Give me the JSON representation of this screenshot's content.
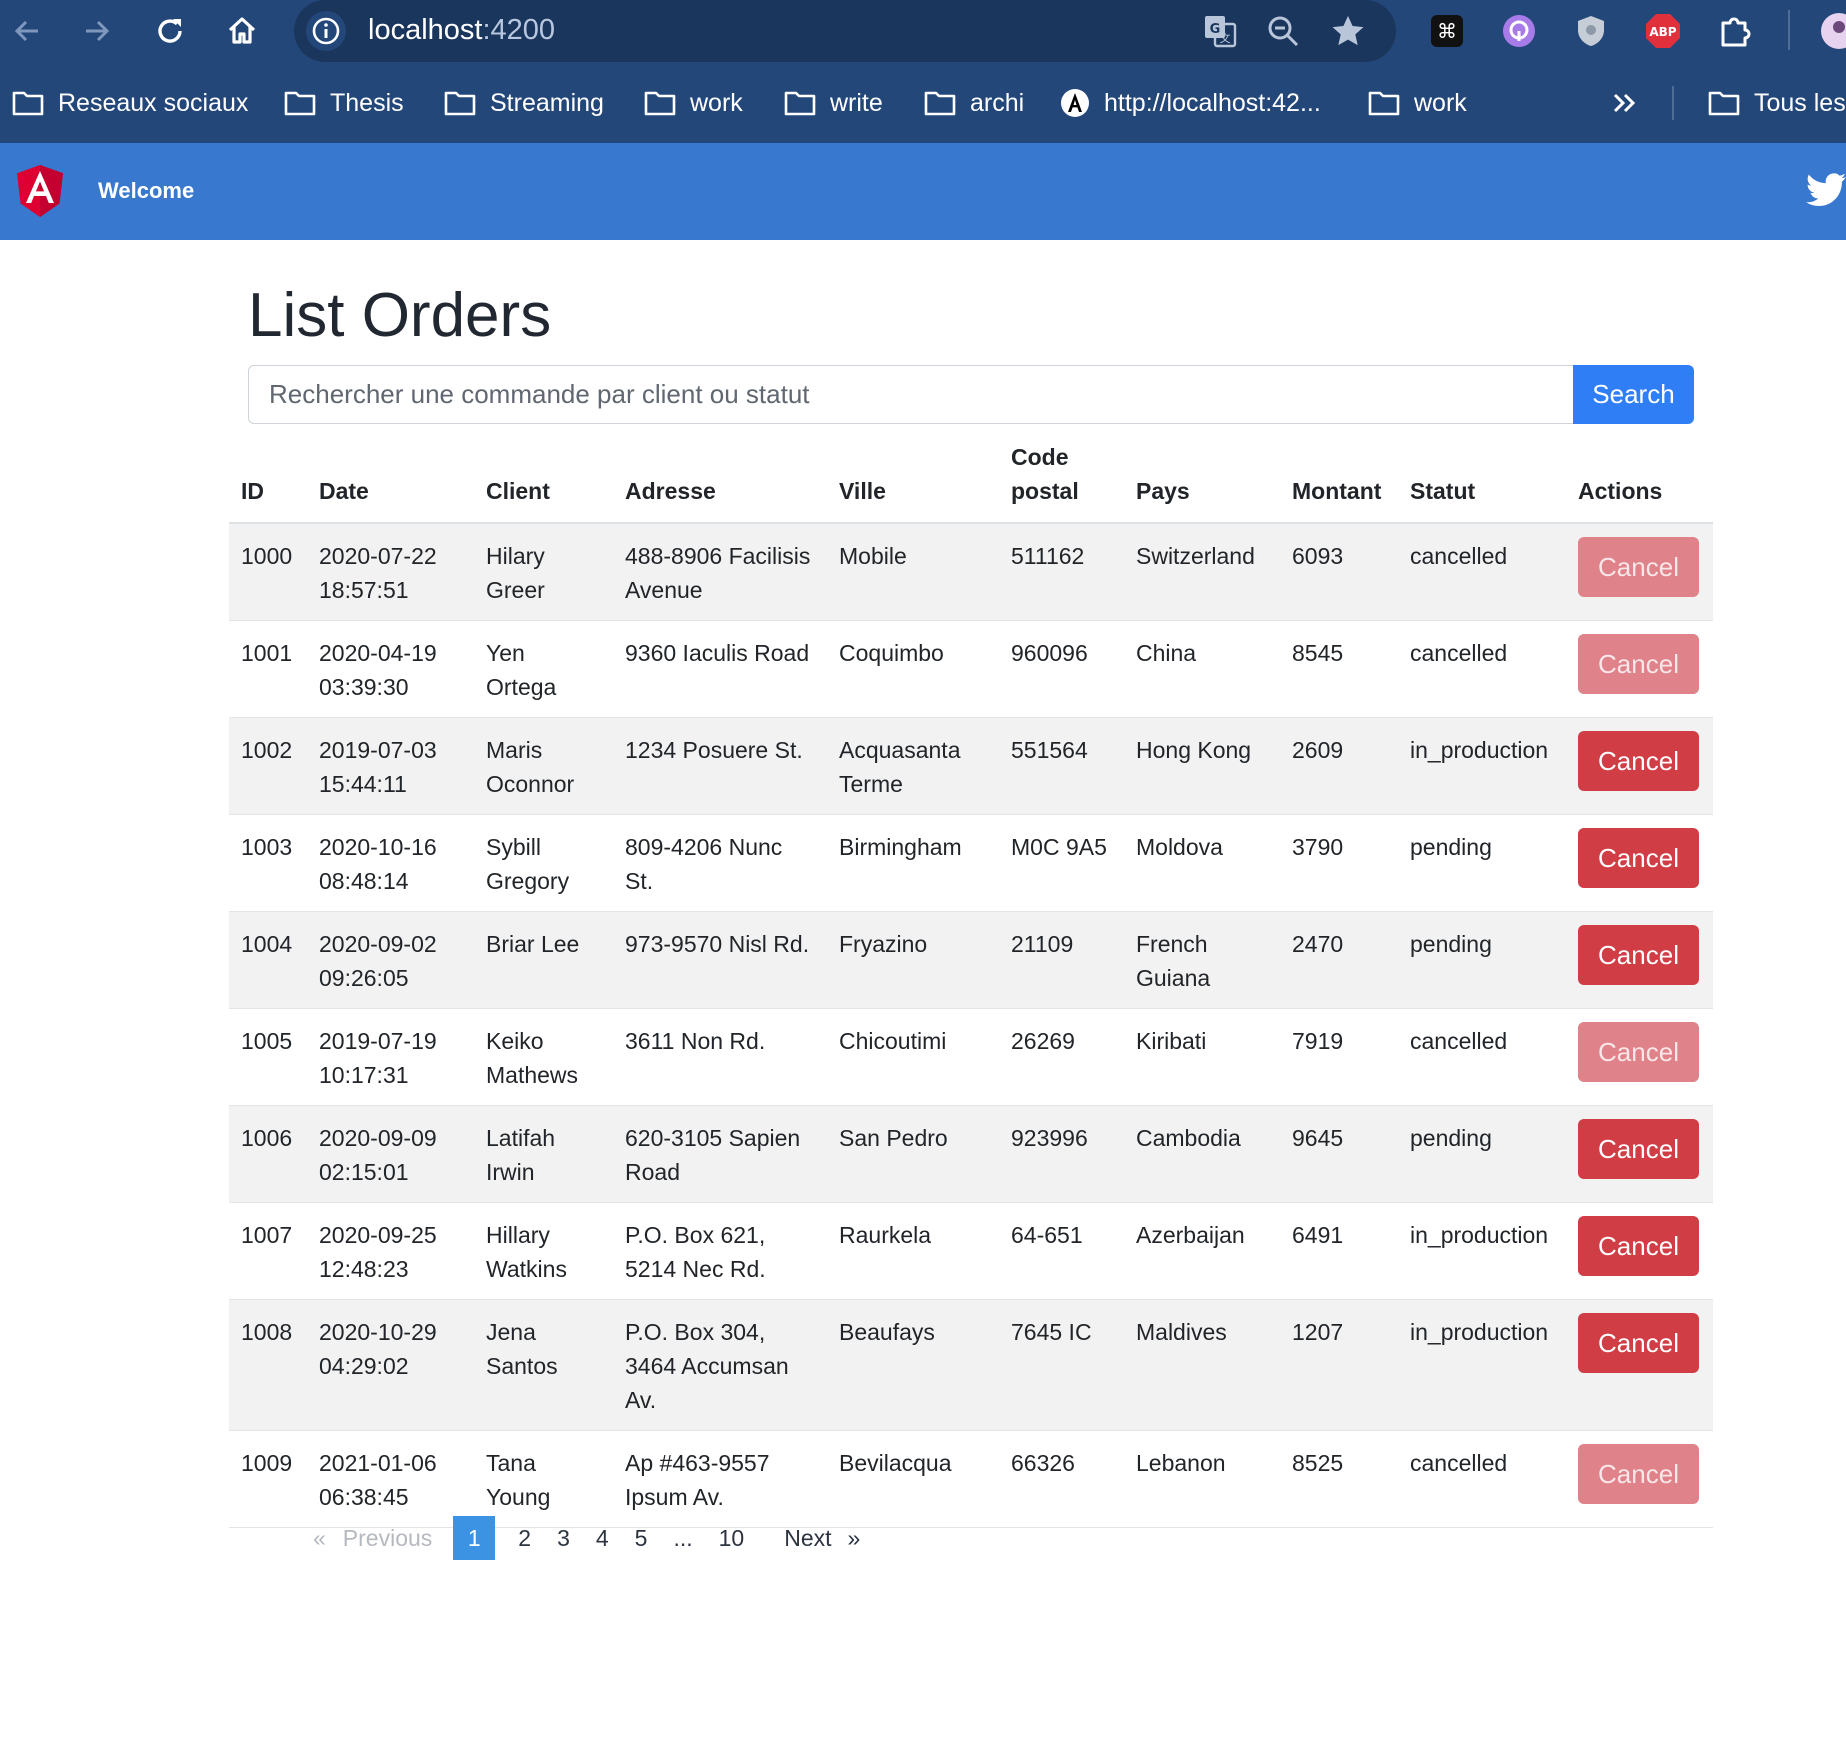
{
  "browser": {
    "url_host": "localhost",
    "url_port": ":4200",
    "bookmarks": [
      {
        "label": "Reseaux sociaux",
        "icon": "folder-icon"
      },
      {
        "label": "Thesis",
        "icon": "folder-icon"
      },
      {
        "label": "Streaming",
        "icon": "folder-icon"
      },
      {
        "label": "work",
        "icon": "folder-icon"
      },
      {
        "label": "write",
        "icon": "folder-icon"
      },
      {
        "label": "archi",
        "icon": "folder-icon"
      },
      {
        "label": "http://localhost:42...",
        "icon": "angular-icon"
      },
      {
        "label": "work",
        "icon": "folder-icon"
      },
      {
        "label": "Tous les",
        "icon": "folder-icon"
      }
    ],
    "extensions": {
      "abp": "ABP"
    }
  },
  "navbar": {
    "welcome": "Welcome"
  },
  "page": {
    "title": "List Orders",
    "search_placeholder": "Rechercher une commande par client ou statut",
    "search_button": "Search"
  },
  "table": {
    "headers": {
      "id": "ID",
      "date": "Date",
      "client": "Client",
      "adresse": "Adresse",
      "ville": "Ville",
      "code_postal": "Code postal",
      "pays": "Pays",
      "montant": "Montant",
      "statut": "Statut",
      "actions": "Actions"
    },
    "cancel_label": "Cancel",
    "rows": [
      {
        "id": "1000",
        "date": "2020-07-22 18:57:51",
        "client": "Hilary Greer",
        "adresse": "488-8906 Facilisis Avenue",
        "ville": "Mobile",
        "code_postal": "511162",
        "pays": "Switzerland",
        "montant": "6093",
        "statut": "cancelled",
        "cancel_disabled": true
      },
      {
        "id": "1001",
        "date": "2020-04-19 03:39:30",
        "client": "Yen Ortega",
        "adresse": "9360 Iaculis Road",
        "ville": "Coquimbo",
        "code_postal": "960096",
        "pays": "China",
        "montant": "8545",
        "statut": "cancelled",
        "cancel_disabled": true
      },
      {
        "id": "1002",
        "date": "2019-07-03 15:44:11",
        "client": "Maris Oconnor",
        "adresse": "1234 Posuere St.",
        "ville": "Acquasanta Terme",
        "code_postal": "551564",
        "pays": "Hong Kong",
        "montant": "2609",
        "statut": "in_production",
        "cancel_disabled": false
      },
      {
        "id": "1003",
        "date": "2020-10-16 08:48:14",
        "client": "Sybill Gregory",
        "adresse": "809-4206 Nunc St.",
        "ville": "Birmingham",
        "code_postal": "M0C 9A5",
        "pays": "Moldova",
        "montant": "3790",
        "statut": "pending",
        "cancel_disabled": false
      },
      {
        "id": "1004",
        "date": "2020-09-02 09:26:05",
        "client": "Briar Lee",
        "adresse": "973-9570 Nisl Rd.",
        "ville": "Fryazino",
        "code_postal": "21109",
        "pays": "French Guiana",
        "montant": "2470",
        "statut": "pending",
        "cancel_disabled": false
      },
      {
        "id": "1005",
        "date": "2019-07-19 10:17:31",
        "client": "Keiko Mathews",
        "adresse": "3611 Non Rd.",
        "ville": "Chicoutimi",
        "code_postal": "26269",
        "pays": "Kiribati",
        "montant": "7919",
        "statut": "cancelled",
        "cancel_disabled": true
      },
      {
        "id": "1006",
        "date": "2020-09-09 02:15:01",
        "client": "Latifah Irwin",
        "adresse": "620-3105 Sapien Road",
        "ville": "San Pedro",
        "code_postal": "923996",
        "pays": "Cambodia",
        "montant": "9645",
        "statut": "pending",
        "cancel_disabled": false
      },
      {
        "id": "1007",
        "date": "2020-09-25 12:48:23",
        "client": "Hillary Watkins",
        "adresse": "P.O. Box 621, 5214 Nec Rd.",
        "ville": "Raurkela",
        "code_postal": "64-651",
        "pays": "Azerbaijan",
        "montant": "6491",
        "statut": "in_production",
        "cancel_disabled": false
      },
      {
        "id": "1008",
        "date": "2020-10-29 04:29:02",
        "client": "Jena Santos",
        "adresse": "P.O. Box 304, 3464 Accumsan Av.",
        "ville": "Beaufays",
        "code_postal": "7645 IC",
        "pays": "Maldives",
        "montant": "1207",
        "statut": "in_production",
        "cancel_disabled": false
      },
      {
        "id": "1009",
        "date": "2021-01-06 06:38:45",
        "client": "Tana Young",
        "adresse": "Ap #463-9557 Ipsum Av.",
        "ville": "Bevilacqua",
        "code_postal": "66326",
        "pays": "Lebanon",
        "montant": "8525",
        "statut": "cancelled",
        "cancel_disabled": true
      }
    ]
  },
  "pagination": {
    "first_symbol": "«",
    "previous": "Previous",
    "pages": [
      "1",
      "2",
      "3",
      "4",
      "5",
      "...",
      "10"
    ],
    "current": "1",
    "next": "Next",
    "last_symbol": "»"
  },
  "colors": {
    "navbar": "#3878ce",
    "search_button": "#2f7ef6",
    "cancel_enabled": "#d03d45",
    "cancel_disabled": "#df8289",
    "page_active": "#3d93e3"
  }
}
